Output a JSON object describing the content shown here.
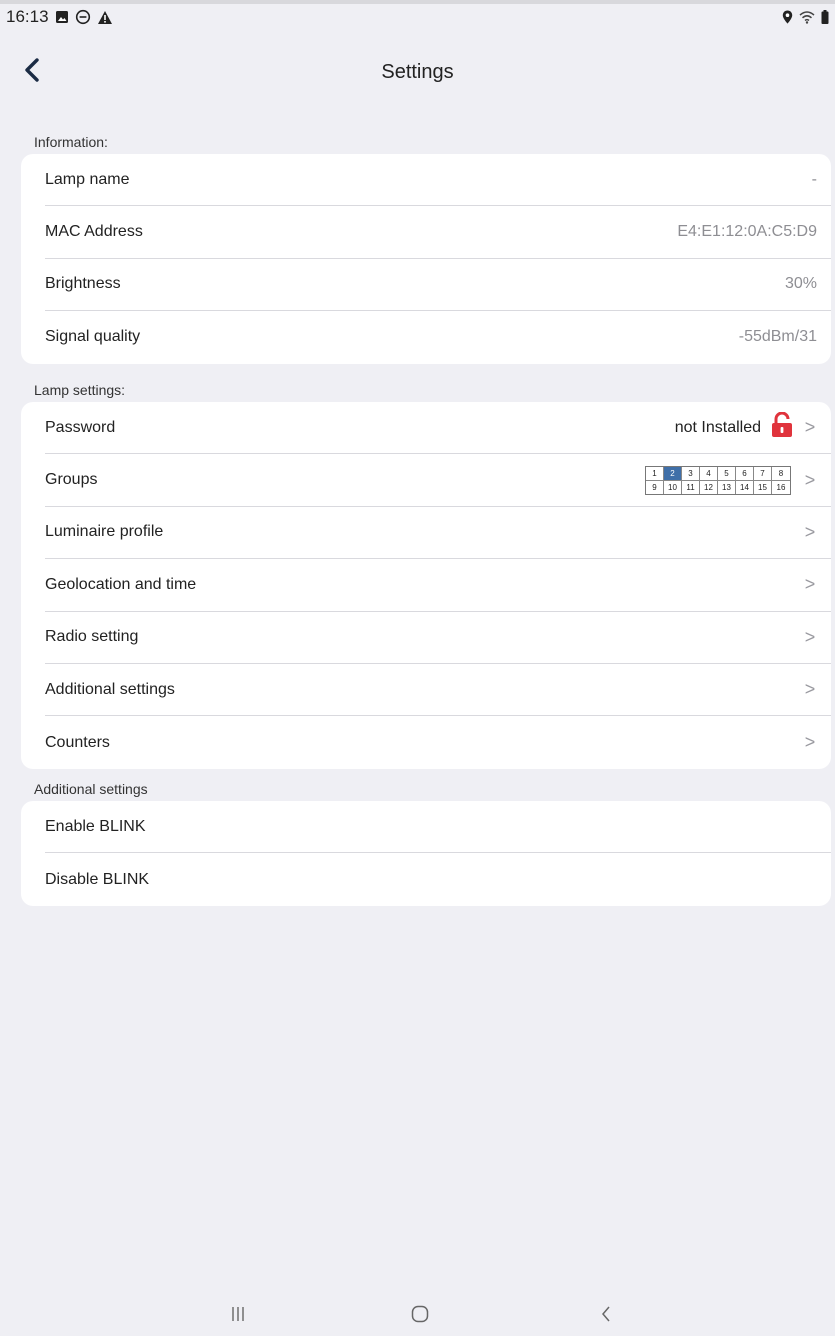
{
  "status_bar": {
    "time": "16:13",
    "left_icons": [
      "gallery-icon",
      "dnd-icon",
      "warning-icon"
    ],
    "right_icons": [
      "location-icon",
      "wifi-icon",
      "battery-icon"
    ]
  },
  "header": {
    "title": "Settings",
    "back_icon": "chevron-left-icon"
  },
  "information": {
    "label": "Information:",
    "rows": [
      {
        "label": "Lamp name",
        "value": "-"
      },
      {
        "label": "MAC Address",
        "value": "E4:E1:12:0A:C5:D9"
      },
      {
        "label": "Brightness",
        "value": "30%"
      },
      {
        "label": "Signal quality",
        "value": "-55dBm/31"
      }
    ]
  },
  "lamp_settings": {
    "label": "Lamp settings:",
    "password": {
      "label": "Password",
      "value": "not Installed",
      "icon": "unlocked-padlock-icon",
      "icon_color": "#e0333c"
    },
    "groups": {
      "label": "Groups",
      "cells": [
        "1",
        "2",
        "3",
        "4",
        "5",
        "6",
        "7",
        "8",
        "9",
        "10",
        "11",
        "12",
        "13",
        "14",
        "15",
        "16"
      ],
      "active": [
        "2"
      ],
      "active_color": "#3f6fa8"
    },
    "rows": [
      {
        "label": "Luminaire profile"
      },
      {
        "label": "Geolocation and time"
      },
      {
        "label": "Radio setting"
      },
      {
        "label": "Additional settings"
      },
      {
        "label": "Counters"
      }
    ],
    "chevron": ">"
  },
  "additional": {
    "label": "Additional settings",
    "rows": [
      {
        "label": "Enable BLINK"
      },
      {
        "label": "Disable BLINK"
      }
    ]
  },
  "nav_bar": {
    "icons": [
      "recent-apps-icon",
      "home-icon",
      "back-icon"
    ]
  }
}
